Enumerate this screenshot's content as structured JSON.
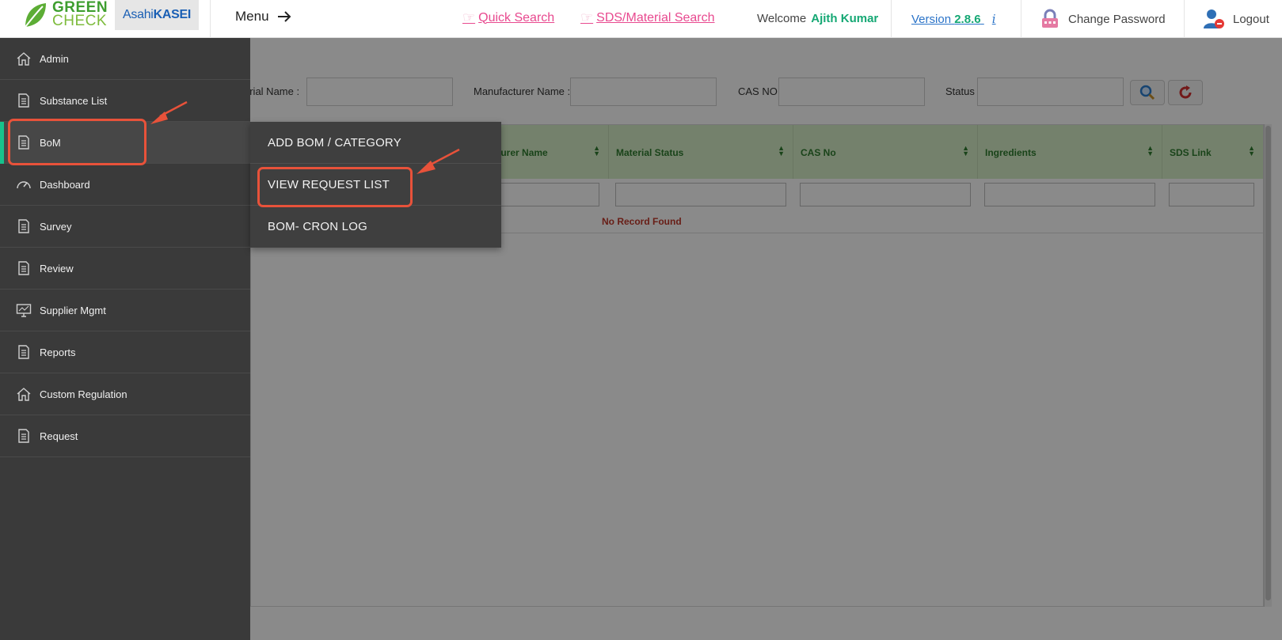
{
  "header": {
    "logo_line1": "GREEN",
    "logo_line2": "CHECK",
    "partner_light": "Asahi",
    "partner_bold": "KASEI",
    "menu_label": "Menu",
    "quick_search": "Quick Search",
    "sds_search": "SDS/Material Search",
    "welcome_label": "Welcome",
    "user_name": "Ajith Kumar",
    "version_label": "Version",
    "version_number": "2.8.6",
    "version_info": "i",
    "change_password": "Change Password",
    "logout": "Logout"
  },
  "filters": {
    "material_name": "erial Name :",
    "manufacturer_name": "Manufacturer Name :",
    "cas_no": "CAS NO:",
    "status": "Status"
  },
  "grid": {
    "columns": [
      "acturer Name",
      "Material Status",
      "CAS No",
      "Ingredients",
      "SDS Link"
    ],
    "empty_message": "No Record Found"
  },
  "sidebar": {
    "items": [
      {
        "label": "Admin"
      },
      {
        "label": "Substance List"
      },
      {
        "label": "BoM"
      },
      {
        "label": "Dashboard"
      },
      {
        "label": "Survey"
      },
      {
        "label": "Review"
      },
      {
        "label": "Supplier Mgmt"
      },
      {
        "label": "Reports"
      },
      {
        "label": "Custom Regulation"
      },
      {
        "label": "Request"
      }
    ]
  },
  "submenu": {
    "items": [
      {
        "label": "ADD BOM / CATEGORY"
      },
      {
        "label": "VIEW REQUEST LIST"
      },
      {
        "label": "BOM- CRON LOG"
      }
    ]
  },
  "colors": {
    "accent_green": "#16c28c",
    "link_pink": "#e8498f",
    "annotation_red": "#e8523a",
    "grid_header": "#d7eec8"
  }
}
